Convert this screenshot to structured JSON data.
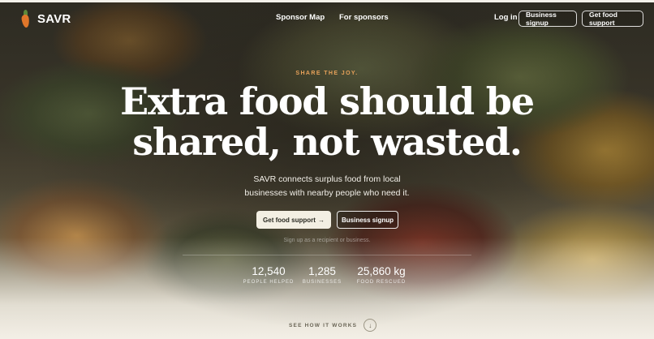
{
  "brand": {
    "name": "SAVR",
    "logo_icon": "carrot-icon"
  },
  "nav": {
    "links": [
      "Sponsor Map",
      "For sponsors"
    ],
    "login": "Log in",
    "business_signup": "Business signup",
    "get_support": "Get food support"
  },
  "hero": {
    "eyebrow": "SHARE THE JOY.",
    "headline_line1": "Extra food should be",
    "headline_line2": "shared, not wasted.",
    "sub_line1": "SAVR connects surplus food from local",
    "sub_line2": "businesses with nearby people who need it.",
    "cta_primary": "Get food support",
    "cta_primary_icon": "→",
    "cta_secondary": "Business signup",
    "hint": "Sign up as a recipient or business."
  },
  "stats": [
    {
      "value": "12,540",
      "label": "PEOPLE HELPED"
    },
    {
      "value": "1,285",
      "label": "BUSINESSES"
    },
    {
      "value": "25,860 kg",
      "label": "FOOD RESCUED"
    }
  ],
  "how": {
    "label": "SEE HOW IT WORKS",
    "icon": "↓"
  },
  "colors": {
    "accent": "#e8a25a",
    "cream": "#f3efe3",
    "carrot": "#e0762a"
  }
}
